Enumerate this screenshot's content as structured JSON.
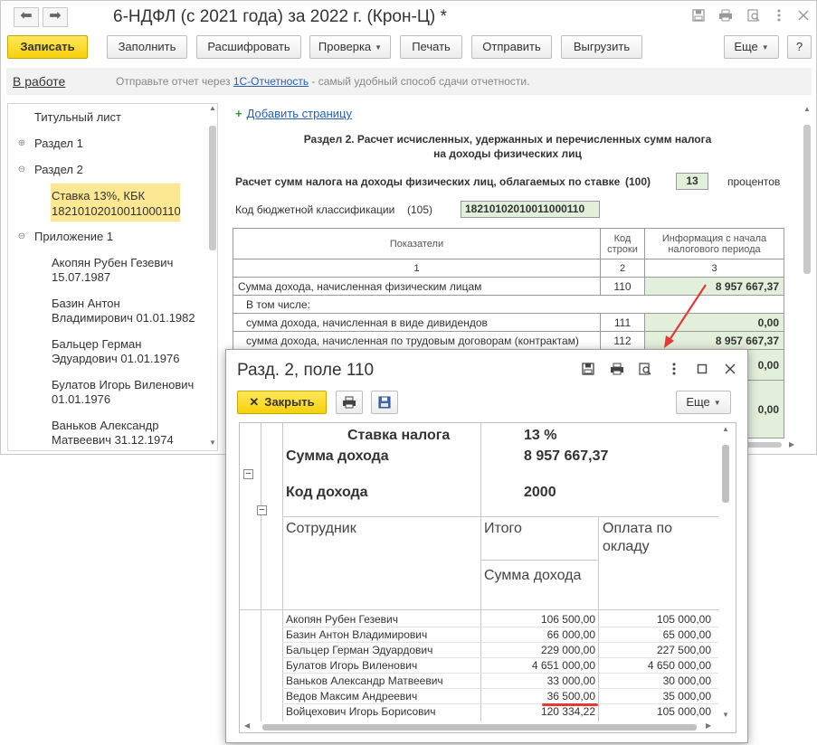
{
  "window": {
    "title": "6-НДФЛ (с 2021 года) за 2022 г. (Крон-Ц) *",
    "nav_back": "⬅",
    "nav_forward": "➡"
  },
  "toolbar": {
    "save": "Записать",
    "fill": "Заполнить",
    "decode": "Расшифровать",
    "check": "Проверка",
    "print": "Печать",
    "send": "Отправить",
    "export": "Выгрузить",
    "more": "Еще",
    "help": "?"
  },
  "infobar": {
    "status": "В работе",
    "message_prefix": "Отправьте отчет через ",
    "message_link": "1С-Отчетность",
    "message_suffix": " - самый удобный способ сдачи отчетности."
  },
  "tree": {
    "title_sheet": "Титульный лист",
    "section1": "Раздел 1",
    "section2": "Раздел 2",
    "section2_item_line1": "Ставка 13%, КБК",
    "section2_item_line2": "18210102010011000110",
    "appendix1": "Приложение 1",
    "employees": [
      {
        "line1": "Акопян Рубен Гезевич",
        "line2": "15.07.1987"
      },
      {
        "line1": "Базин Антон",
        "line2": "Владимирович 01.01.1982"
      },
      {
        "line1": "Бальцер Герман",
        "line2": "Эдуардович 01.01.1976"
      },
      {
        "line1": "Булатов Игорь Виленович",
        "line2": "01.01.1976"
      },
      {
        "line1": "Ваньков Александр",
        "line2": "Матвеевич 31.12.1974"
      }
    ]
  },
  "report": {
    "add_page": "Добавить страницу",
    "title_line1": "Раздел 2. Расчет исчисленных, удержанных и перечисленных сумм налога",
    "title_line2": "на доходы физических лиц",
    "rate_label": "Расчет сумм налога на доходы физических лиц, облагаемых по ставке",
    "rate_code": "(100)",
    "rate_value": "13",
    "rate_unit": "процентов",
    "kbk_label": "Код бюджетной классификации",
    "kbk_code": "(105)",
    "kbk_value": "18210102010011000110",
    "table": {
      "col1": "Показатели",
      "col2": "Код строки",
      "col3": "Информация с начала налогового периода",
      "num1": "1",
      "num2": "2",
      "num3": "3",
      "rows": [
        {
          "label": "Сумма дохода, начисленная физическим лицам",
          "code": "110",
          "value": "8 957 667,37"
        },
        {
          "label": "В том числе:",
          "code": "",
          "value": ""
        },
        {
          "label": "сумма дохода, начисленная в виде дивидендов",
          "code": "111",
          "value": "0,00"
        },
        {
          "label": "сумма дохода, начисленная по трудовым договорам (контрактам)",
          "code": "112",
          "value": "8 957 667,37"
        }
      ],
      "extra_values": [
        "0,00",
        "0,00"
      ]
    }
  },
  "popup": {
    "title": "Разд. 2, поле 110",
    "close": "Закрыть",
    "more": "Еще",
    "rate_label": "Ставка налога",
    "rate_value": "13 %",
    "income_label": "Сумма дохода",
    "income_value": "8 957 667,37",
    "code_label": "Код дохода",
    "code_value": "2000",
    "col_employee": "Сотрудник",
    "col_total": "Итого",
    "col_salary_line1": "Оплата по",
    "col_salary_line2": "окладу",
    "col_income": "Сумма дохода",
    "rows": [
      {
        "name": "Акопян Рубен Гезевич",
        "total": "106 500,00",
        "salary": "105 000,00"
      },
      {
        "name": "Базин Антон Владимирович",
        "total": "66 000,00",
        "salary": "65 000,00"
      },
      {
        "name": "Бальцер Герман Эдуардович",
        "total": "229 000,00",
        "salary": "227 500,00"
      },
      {
        "name": "Булатов Игорь Виленович",
        "total": "4 651 000,00",
        "salary": "4 650 000,00"
      },
      {
        "name": "Ваньков Александр Матвеевич",
        "total": "33 000,00",
        "salary": "30 000,00"
      },
      {
        "name": "Ведов Максим Андреевич",
        "total": "36 500,00",
        "salary": "35 000,00"
      },
      {
        "name": "Войцехович Игорь Борисович",
        "total": "120 334,22",
        "salary": "105 000,00"
      }
    ]
  },
  "colors": {
    "accent_yellow": "#f7d10c",
    "selected_tree": "#fce792",
    "cell_green": "#e2efda",
    "annotation_red": "#e53935",
    "link_blue": "#2a60b8"
  }
}
